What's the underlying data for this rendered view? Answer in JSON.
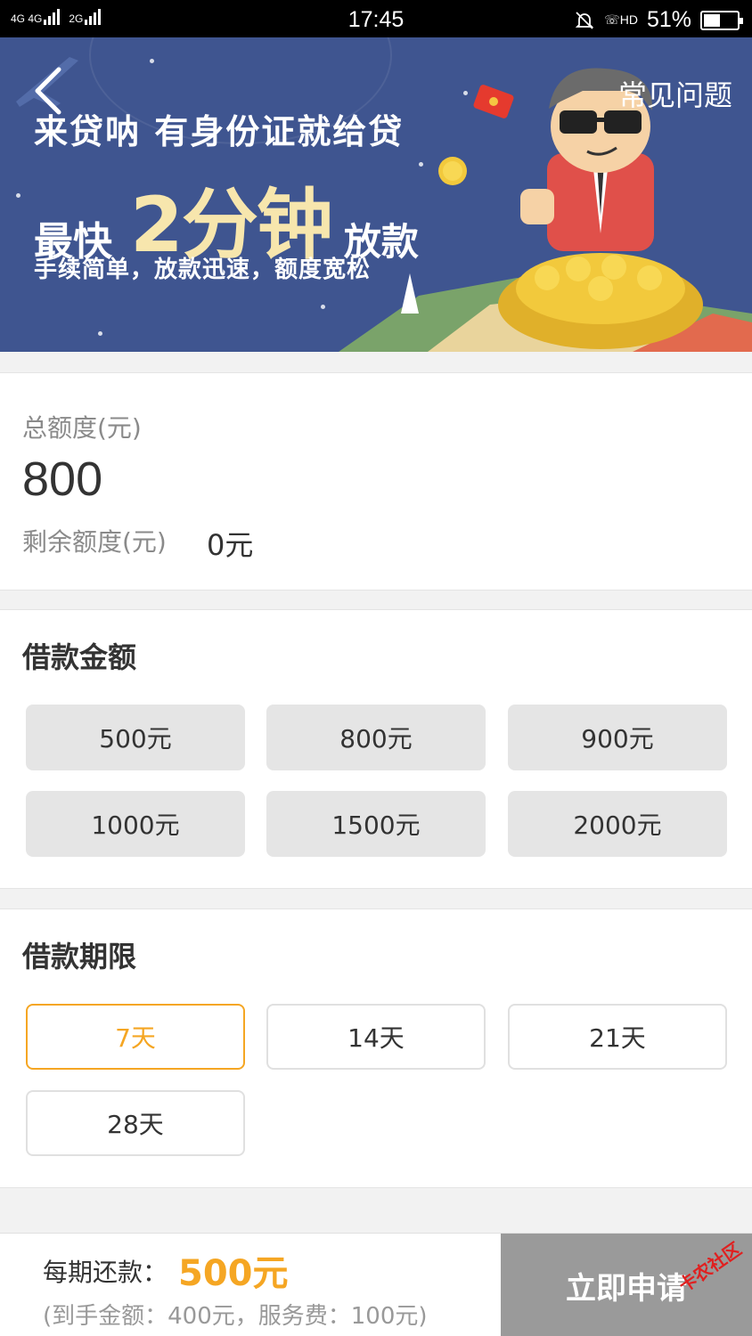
{
  "status_bar": {
    "network": "4G 4G",
    "network2": "2G",
    "time": "17:45",
    "hd": "HD",
    "battery": "51%",
    "battery_level": 0.51
  },
  "banner": {
    "faq": "常见问题",
    "slogan": "来贷呐 有身份证就给贷",
    "headline_prefix": "最快",
    "headline_big": "2分钟",
    "headline_suffix": "放款",
    "subline": "手续简单，放款迅速，额度宽松"
  },
  "credit": {
    "total_label": "总额度(元)",
    "total_value": "800",
    "remaining_label": "剩余额度(元)",
    "remaining_value": "0元"
  },
  "loan_amount": {
    "title": "借款金额",
    "options": [
      "500元",
      "800元",
      "900元",
      "1000元",
      "1500元",
      "2000元"
    ]
  },
  "loan_period": {
    "title": "借款期限",
    "options": [
      "7天",
      "14天",
      "21天",
      "28天"
    ],
    "selected": "7天"
  },
  "footer": {
    "per_label": "每期还款：",
    "per_value": "500元",
    "detail": "(到手金额：400元，服务费：100元)",
    "apply": "立即申请",
    "watermark": "卡农社区"
  },
  "colors": {
    "accent": "#f5a623",
    "banner_bg": "#3f5590",
    "apply_bg": "#9a9a9a"
  }
}
